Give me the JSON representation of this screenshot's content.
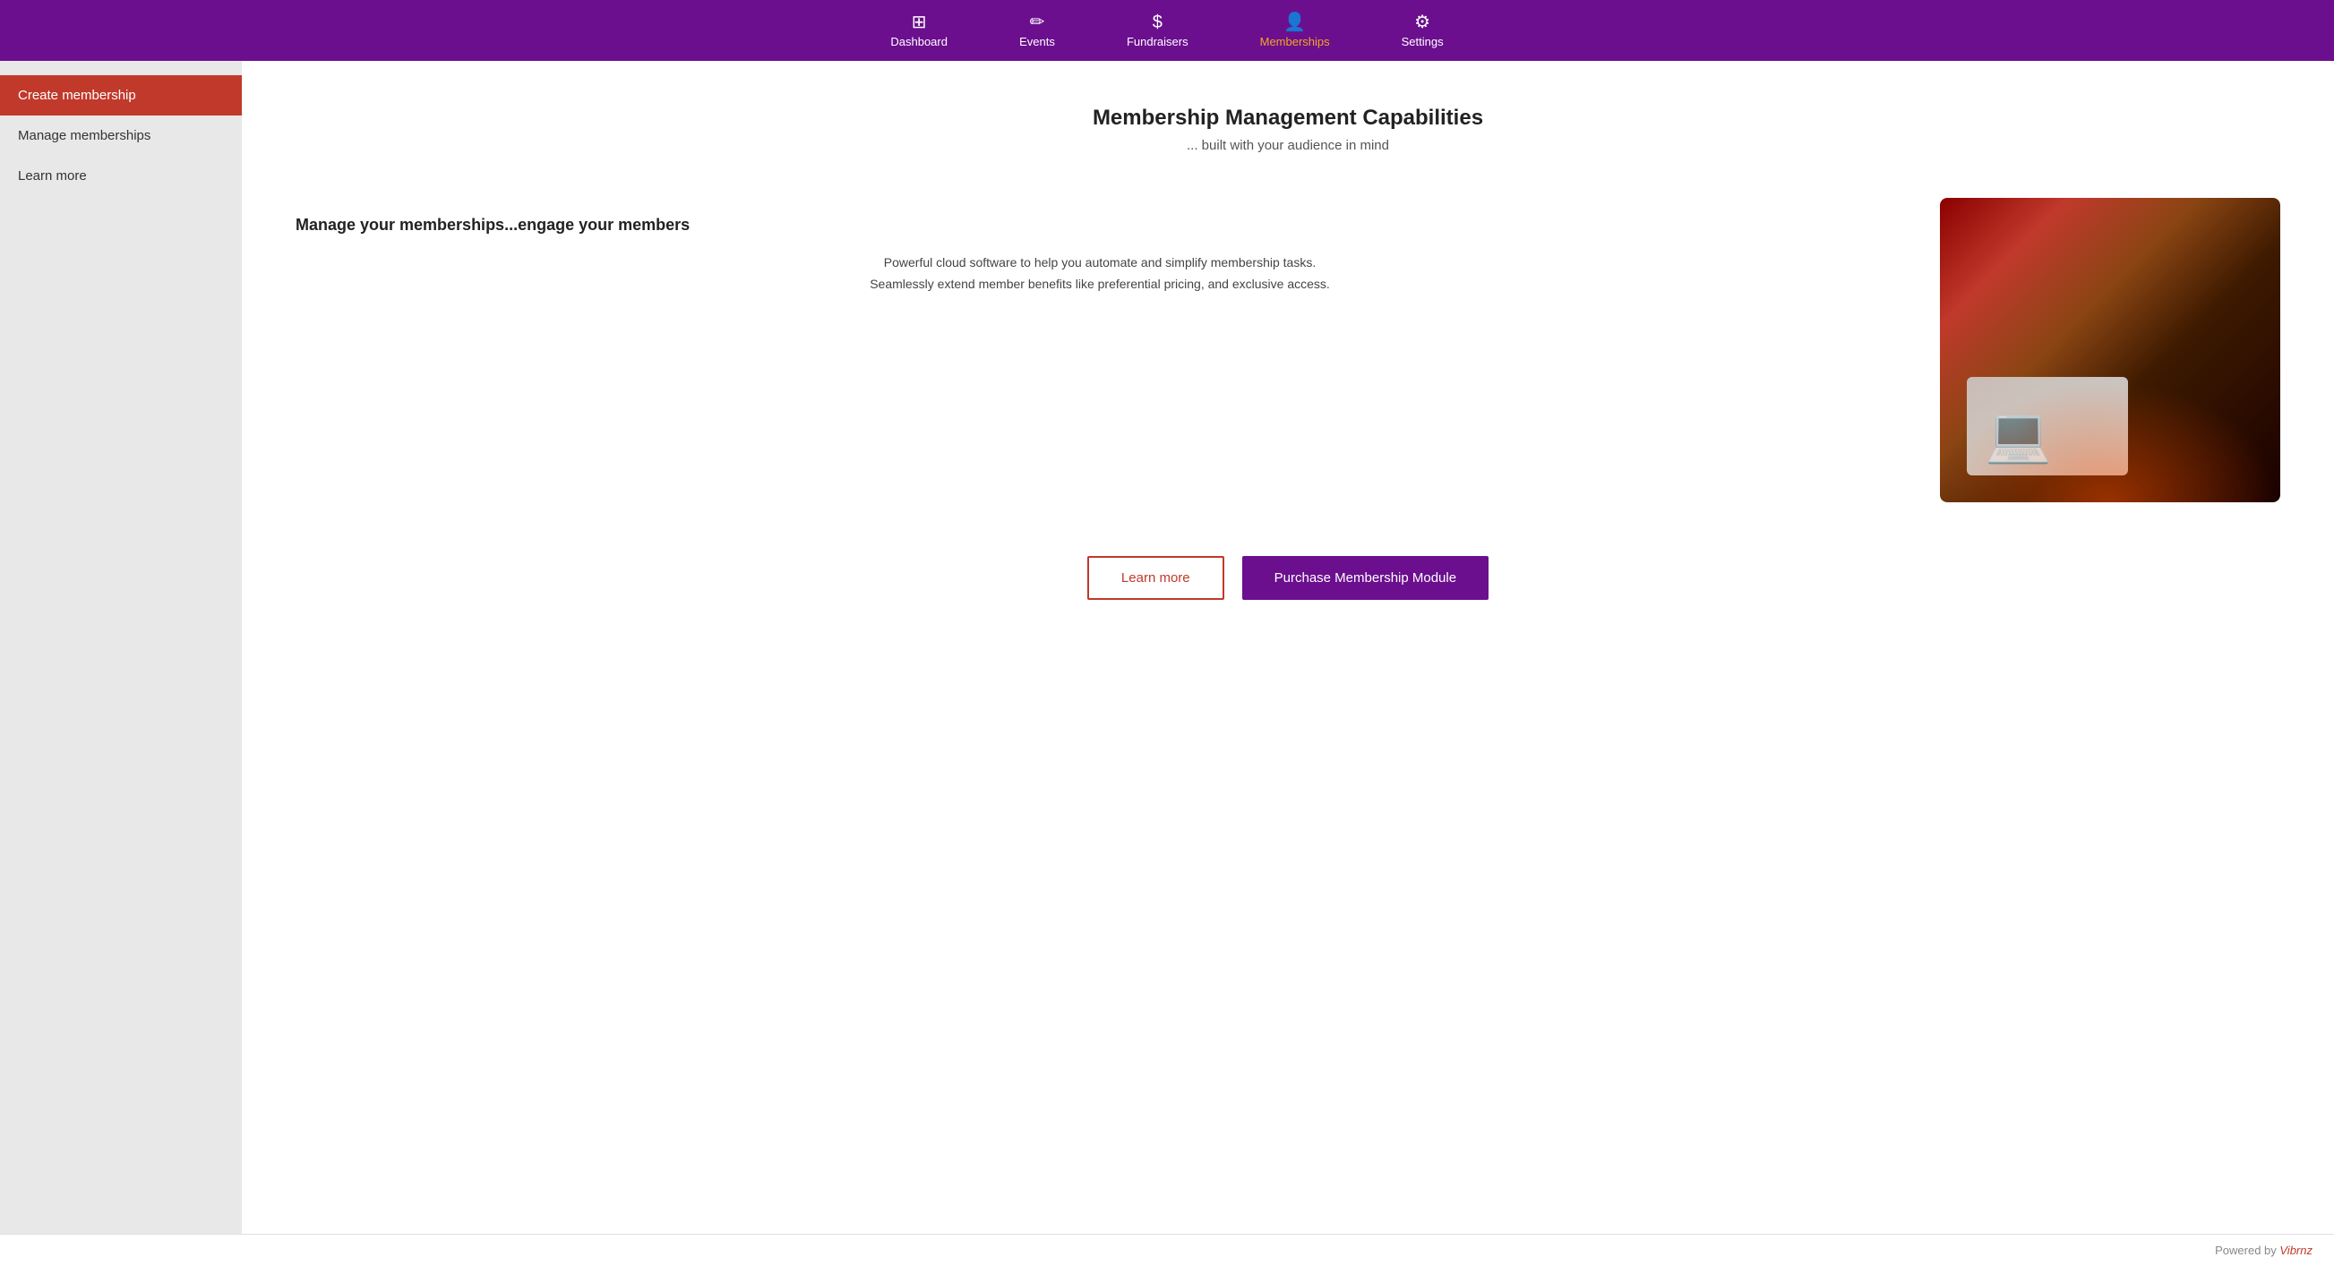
{
  "nav": {
    "items": [
      {
        "id": "dashboard",
        "label": "Dashboard",
        "icon": "⊞",
        "active": false
      },
      {
        "id": "events",
        "label": "Events",
        "icon": "✏",
        "active": false
      },
      {
        "id": "fundraisers",
        "label": "Fundraisers",
        "icon": "$",
        "active": false
      },
      {
        "id": "memberships",
        "label": "Memberships",
        "icon": "👤",
        "active": true
      },
      {
        "id": "settings",
        "label": "Settings",
        "icon": "⚙",
        "active": false
      }
    ]
  },
  "sidebar": {
    "items": [
      {
        "id": "create-membership",
        "label": "Create membership",
        "active": true
      },
      {
        "id": "manage-memberships",
        "label": "Manage memberships",
        "active": false
      },
      {
        "id": "learn-more",
        "label": "Learn more",
        "active": false
      }
    ]
  },
  "main": {
    "title": "Membership Management Capabilities",
    "subtitle": "... built with your audience in mind",
    "heading": "Manage your memberships...engage your members",
    "description_line1": "Powerful cloud software to help you automate and simplify membership tasks.",
    "description_line2": "Seamlessly extend member benefits like preferential pricing, and exclusive access.",
    "buttons": {
      "learn_more": "Learn more",
      "purchase": "Purchase Membership Module"
    }
  },
  "footer": {
    "powered_by": "Powered by ",
    "brand": "Vibrnz"
  }
}
